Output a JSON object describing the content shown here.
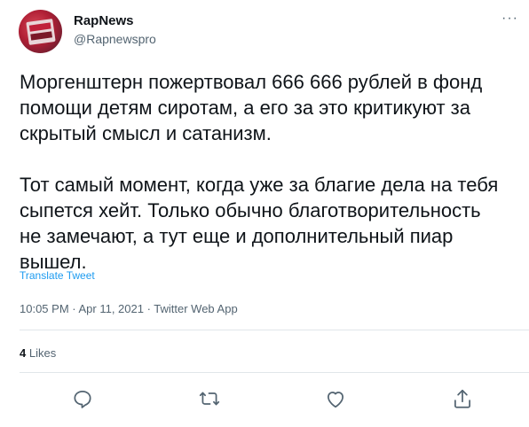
{
  "tweet": {
    "display_name": "RapNews",
    "handle": "@Rapnewspro",
    "more_icon": "more-horizontal-icon",
    "text": "Моргенштерн пожертвовал 666 666 рублей в фонд\nпомощи детям сиротам, а его за это критикуют за\nскрытый смысл и сатанизм.\n\nТот самый момент, когда уже за благие дела на тебя\nсыпется хейт. Только обычно благотворительность\nне замечают, а тут еще и дополнительный пиар\nвышел.",
    "translate_label": "Translate Tweet",
    "timestamp": "10:05 PM · Apr 11, 2021 · Twitter Web App",
    "likes_count": "4",
    "likes_label": "Likes"
  },
  "actions": {
    "reply_icon": "reply-icon",
    "retweet_icon": "retweet-icon",
    "like_icon": "heart-icon",
    "share_icon": "share-icon"
  },
  "colors": {
    "link": "#1d9bf0",
    "secondary_text": "#536471",
    "primary_text": "#0f1419",
    "divider": "#e1e6ea"
  }
}
